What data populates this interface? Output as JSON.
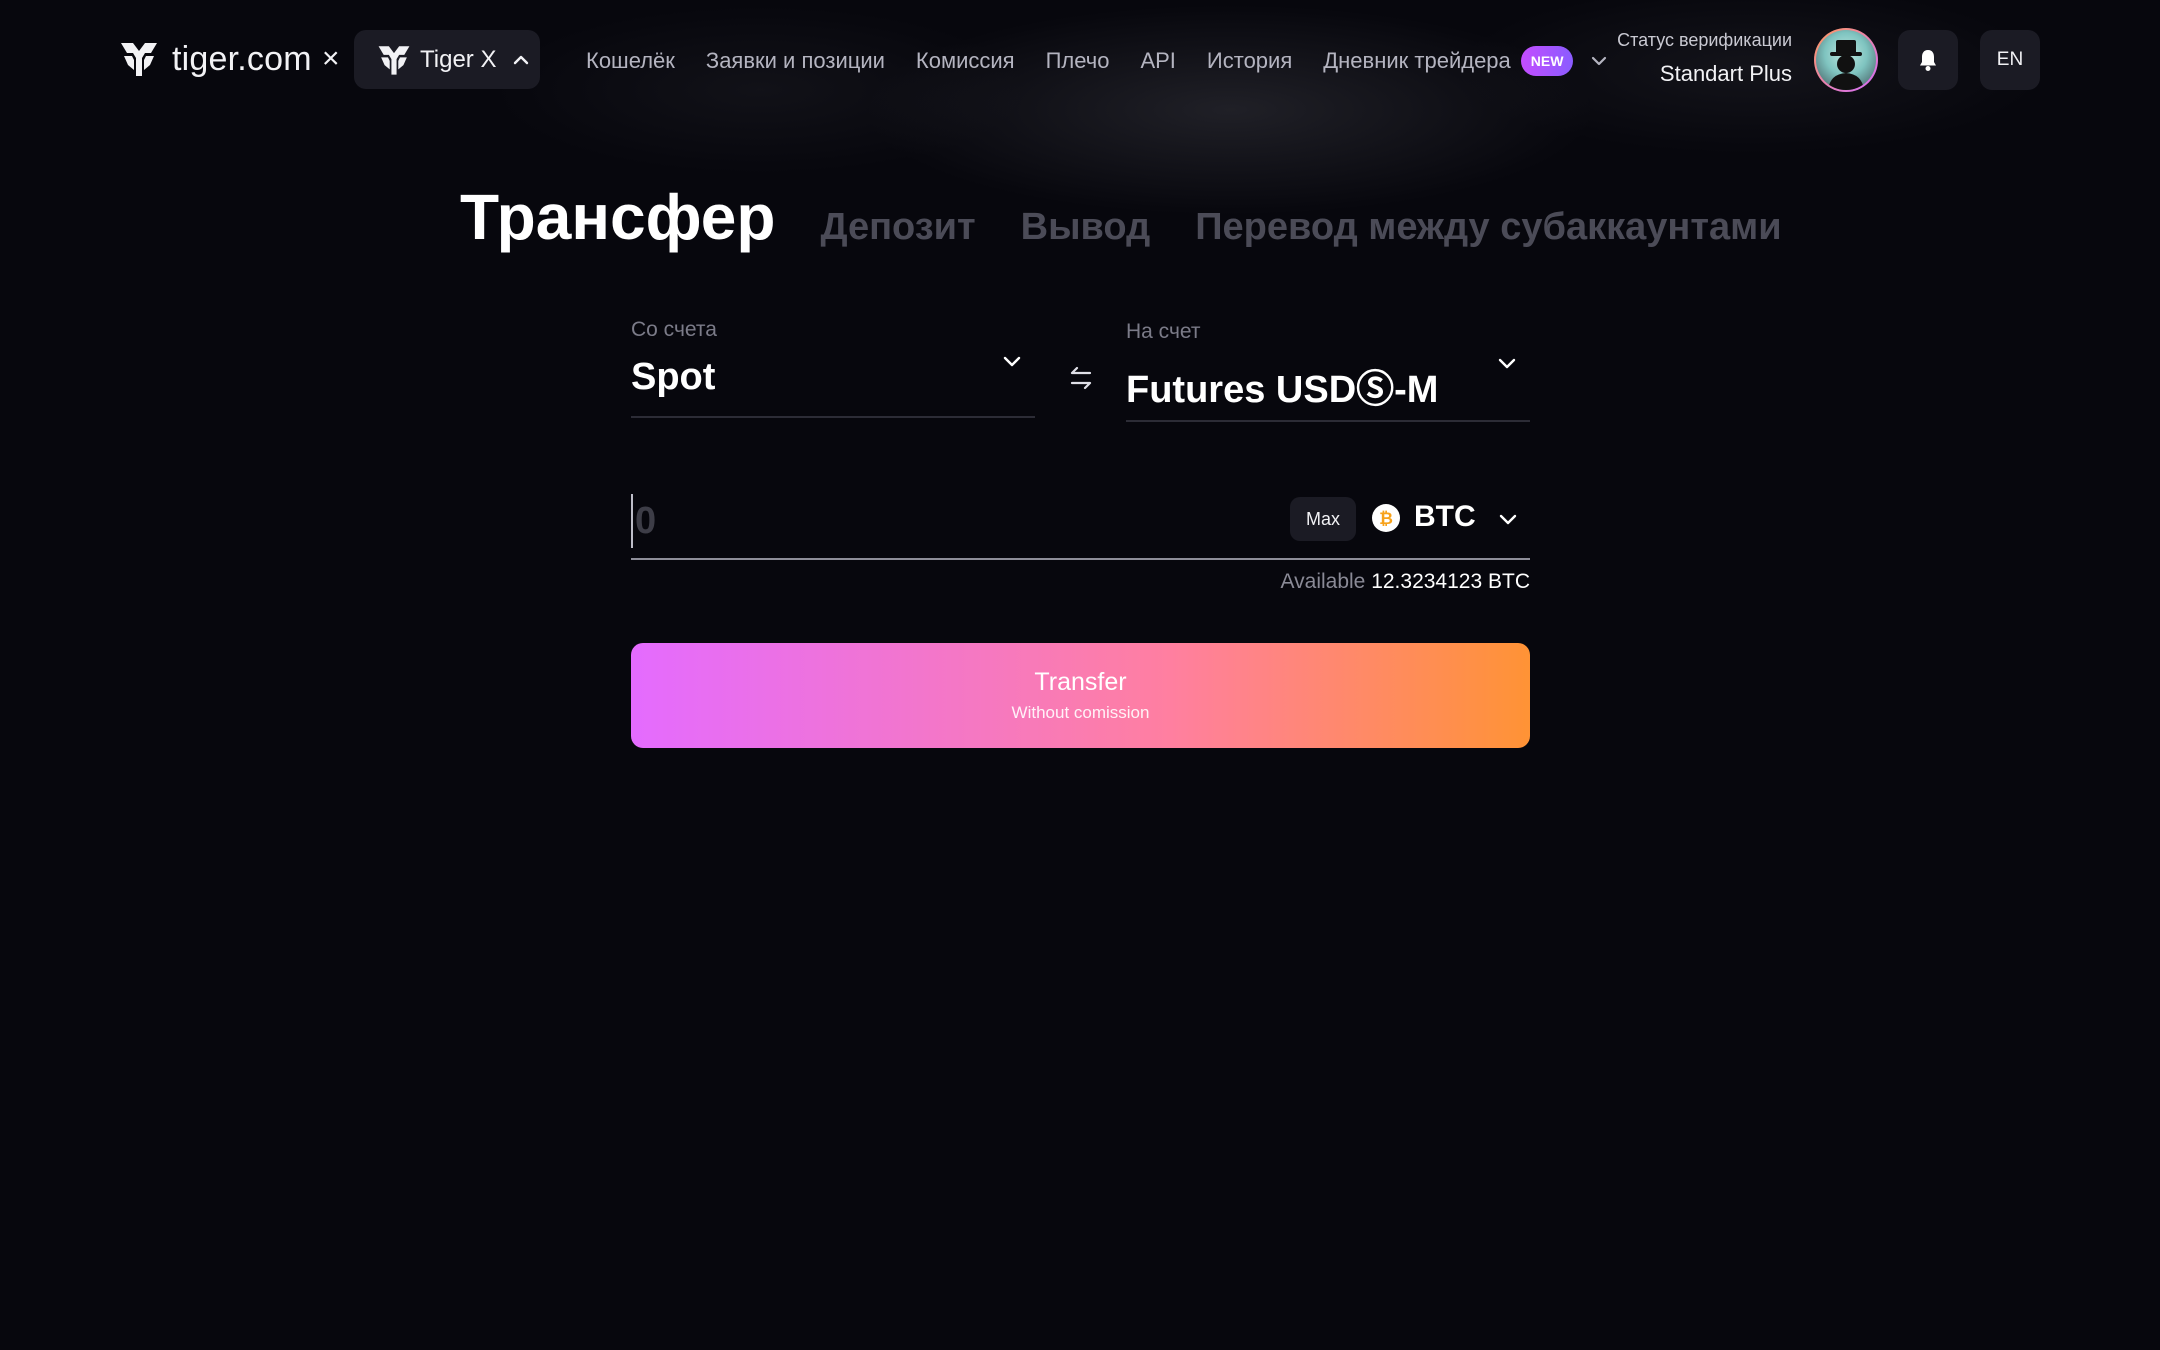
{
  "brand": {
    "logo_text": "tiger.com",
    "separator": "×",
    "product": "Tiger X"
  },
  "nav": {
    "items": [
      "Кошелёк",
      "Заявки и позиции",
      "Комиссия",
      "Плечо",
      "API",
      "История",
      "Дневник трейдера"
    ],
    "badge": "NEW"
  },
  "verification": {
    "label": "Статус верификации",
    "value": "Standart Plus"
  },
  "language": "EN",
  "tabs": {
    "active": "Трансфер",
    "items": [
      "Депозит",
      "Вывод",
      "Перевод между субаккаунтами"
    ]
  },
  "form": {
    "from": {
      "label": "Со счета",
      "value": "Spot"
    },
    "to": {
      "label": "На счет",
      "value": "Futures USDⓈ-M"
    },
    "amount": {
      "placeholder": "0",
      "value": ""
    },
    "max_label": "Max",
    "currency": "BTC",
    "available": {
      "label": "Available",
      "value": "12.3234123 BTC"
    },
    "submit": {
      "title": "Transfer",
      "subtitle": "Without comission"
    }
  },
  "colors": {
    "background": "#07070d",
    "button_gradient_start": "#e46bff",
    "button_gradient_end": "#ff9335",
    "badge_new": "#c44dff",
    "inactive_tab": "#4b4b57"
  },
  "icons": [
    "tiger-logo-icon",
    "chevron-up-icon",
    "chevron-down-icon",
    "swap-arrows-icon",
    "bitcoin-icon",
    "bell-icon",
    "avatar"
  ]
}
